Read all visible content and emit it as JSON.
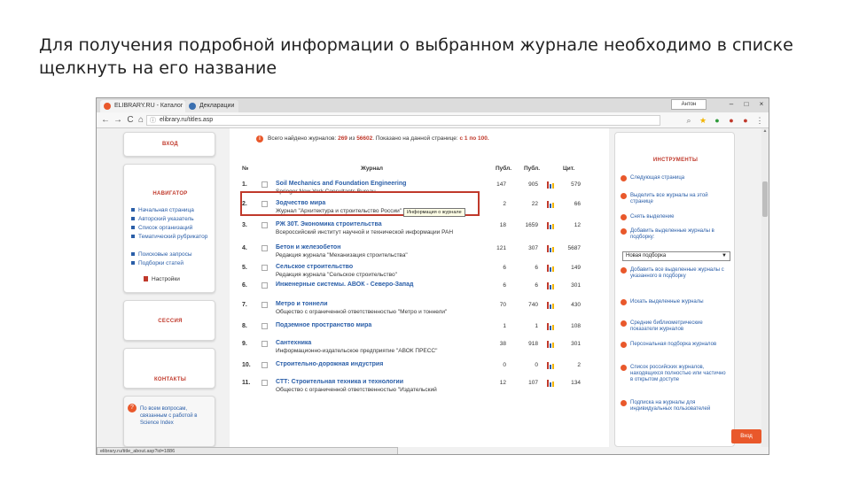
{
  "caption": "Для получения подробной информации о выбранном журнале необходимо в списке щелкнуть на его название",
  "browser": {
    "tabs": [
      {
        "label": "ELIBRARY.RU - Каталог"
      },
      {
        "label": "Декларации"
      }
    ],
    "user_chip": "Антон",
    "window_controls": [
      "–",
      "□",
      "×"
    ],
    "nav": {
      "back": "←",
      "forward": "→",
      "reload": "C",
      "home": "⌂"
    },
    "url": "elibrary.ru/titles.asp",
    "status_url": "elibrary.ru/title_about.asp?id=1886"
  },
  "left": {
    "login": "ВХОД",
    "navigator": {
      "header": "НАВИГАТОР",
      "items": [
        "Начальная страница",
        "Авторский указатель",
        "Список организаций",
        "Тематический рубрикатор",
        "Поисковые запросы",
        "Подборки статей"
      ],
      "settings": "Настройки"
    },
    "session": "СЕССИЯ",
    "contacts": "КОНТАКТЫ",
    "help_text": "По всем вопросам, связанным с работой в Science Index"
  },
  "center": {
    "stats": {
      "prefix": "Всего найдено журналов:",
      "found": "269",
      "of": "из",
      "total": "56602",
      "shown_prefix": ". Показано на данной странице:",
      "range": "с 1 по 100."
    },
    "columns": {
      "num": "№",
      "journal": "Журнал",
      "pubs": "Публ.",
      "issues": "Публ.",
      "cit": "Цит."
    },
    "tooltip": "Информация о журнале",
    "rows": [
      {
        "n": "1.",
        "title": "Soil Mechanics and Foundation Engineering",
        "pub": "Springer New York Consultants Bureau",
        "a": "147",
        "b": "905",
        "c": "579"
      },
      {
        "n": "2.",
        "title": "Зодчество мира",
        "pub": "Журнал \"Архитектура и строительство России\"",
        "a": "2",
        "b": "22",
        "c": "66"
      },
      {
        "n": "3.",
        "title": "РЖ 30Т. Экономика строительства",
        "pub": "Всероссийский институт научной и технической информации РАН",
        "a": "18",
        "b": "1659",
        "c": "12"
      },
      {
        "n": "4.",
        "title": "Бетон и железобетон",
        "pub": "Редакция журнала \"Механизация строительства\"",
        "a": "121",
        "b": "307",
        "c": "5687"
      },
      {
        "n": "5.",
        "title": "Сельское строительство",
        "pub": "Редакция журнала \"Сельское строительство\"",
        "a": "6",
        "b": "6",
        "c": "149"
      },
      {
        "n": "6.",
        "title": "Инженерные системы. АВОК - Северо-Запад",
        "pub": "",
        "a": "6",
        "b": "6",
        "c": "301"
      },
      {
        "n": "7.",
        "title": "Метро и тоннели",
        "pub": "Общество с ограниченной ответственностью \"Метро и тоннели\"",
        "a": "70",
        "b": "740",
        "c": "430"
      },
      {
        "n": "8.",
        "title": "Подземное пространство мира",
        "pub": "",
        "a": "1",
        "b": "1",
        "c": "108"
      },
      {
        "n": "9.",
        "title": "Сантехника",
        "pub": "Информационно-издательское предприятие \"АВОК ПРЕСС\"",
        "a": "38",
        "b": "918",
        "c": "301"
      },
      {
        "n": "10.",
        "title": "Строительно-дорожная индустрия",
        "pub": "",
        "a": "0",
        "b": "0",
        "c": "2"
      },
      {
        "n": "11.",
        "title": "СТТ: Строительная техника и технологии",
        "pub": "Общество с ограниченной ответственностью \"Издательский",
        "a": "12",
        "b": "107",
        "c": "134"
      }
    ]
  },
  "right": {
    "header": "ИНСТРУМЕНТЫ",
    "actions": [
      "Следующая страница",
      "Выделить все журналы на этой странице",
      "Снять выделение",
      "Добавить выделенные журналы в подборку:",
      "Добавить все выделенные журналы с указанного в подборку",
      "Искать выделенные журналы",
      "Средние библиометрические показатели журналов",
      "Персональная подборка журналов",
      "Список российских журналов, находящихся полностью или частично в открытом доступе",
      "Подписка на журналы для индивидуальных пользователей"
    ],
    "select_value": "Новая подборка",
    "enter_button": "Вход"
  },
  "colors": {
    "accent": "#e9582b",
    "highlight": "#c0392b",
    "link": "#2a5ea8"
  }
}
